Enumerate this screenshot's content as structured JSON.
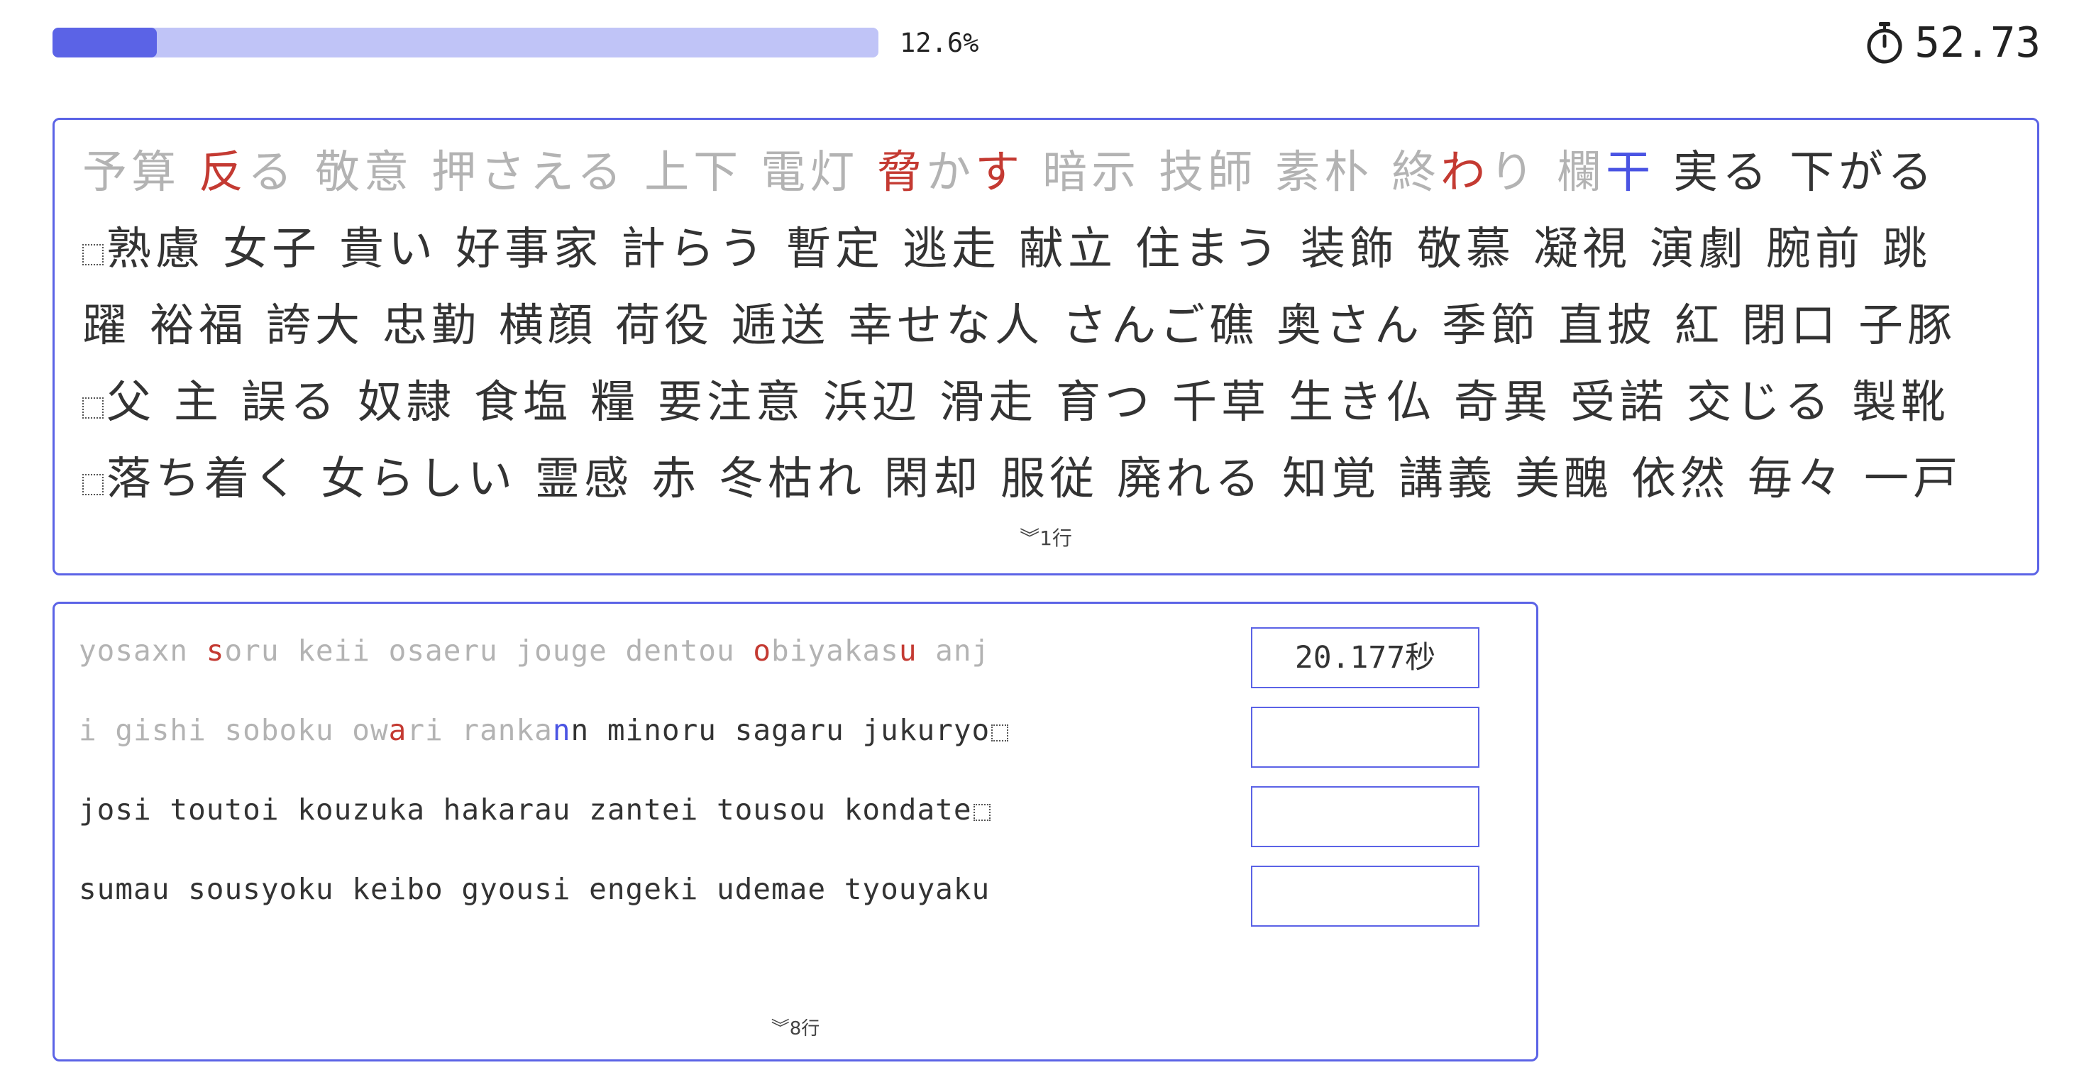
{
  "progress": {
    "fraction": 0.126,
    "label": "12.6%"
  },
  "timer": {
    "icon": "stopwatch-icon",
    "value": "52.73"
  },
  "kanji_panel": {
    "rows": [
      {
        "newline_mark": false,
        "words": [
          {
            "segments": [
              {
                "t": "予算",
                "s": "done"
              }
            ]
          },
          {
            "segments": [
              {
                "t": "反",
                "s": "miss"
              },
              {
                "t": "る",
                "s": "done"
              }
            ]
          },
          {
            "segments": [
              {
                "t": "敬意",
                "s": "done"
              }
            ]
          },
          {
            "segments": [
              {
                "t": "押さえる",
                "s": "done"
              }
            ]
          },
          {
            "segments": [
              {
                "t": "上下",
                "s": "done"
              }
            ]
          },
          {
            "segments": [
              {
                "t": "電灯",
                "s": "done"
              }
            ]
          },
          {
            "segments": [
              {
                "t": "脅",
                "s": "miss"
              },
              {
                "t": "か",
                "s": "done"
              },
              {
                "t": "す",
                "s": "miss"
              }
            ]
          },
          {
            "segments": [
              {
                "t": "暗示",
                "s": "done"
              }
            ]
          },
          {
            "segments": [
              {
                "t": "技師",
                "s": "done"
              }
            ]
          },
          {
            "segments": [
              {
                "t": "素朴",
                "s": "done"
              }
            ]
          },
          {
            "segments": [
              {
                "t": "終",
                "s": "done"
              },
              {
                "t": "わ",
                "s": "miss"
              },
              {
                "t": "り",
                "s": "done"
              }
            ]
          },
          {
            "segments": [
              {
                "t": "欄",
                "s": "done"
              },
              {
                "t": "干",
                "s": "current"
              }
            ]
          },
          {
            "segments": [
              {
                "t": "実る",
                "s": "todo"
              }
            ]
          },
          {
            "segments": [
              {
                "t": "下がる",
                "s": "todo"
              }
            ]
          }
        ]
      },
      {
        "newline_mark": true,
        "words": [
          {
            "segments": [
              {
                "t": "熟慮",
                "s": "todo"
              }
            ]
          },
          {
            "segments": [
              {
                "t": "女子",
                "s": "todo"
              }
            ]
          },
          {
            "segments": [
              {
                "t": "貴い",
                "s": "todo"
              }
            ]
          },
          {
            "segments": [
              {
                "t": "好事家",
                "s": "todo"
              }
            ]
          },
          {
            "segments": [
              {
                "t": "計らう",
                "s": "todo"
              }
            ]
          },
          {
            "segments": [
              {
                "t": "暫定",
                "s": "todo"
              }
            ]
          },
          {
            "segments": [
              {
                "t": "逃走",
                "s": "todo"
              }
            ]
          },
          {
            "segments": [
              {
                "t": "献立",
                "s": "todo"
              }
            ]
          },
          {
            "segments": [
              {
                "t": "住まう",
                "s": "todo"
              }
            ]
          },
          {
            "segments": [
              {
                "t": "装飾",
                "s": "todo"
              }
            ]
          },
          {
            "segments": [
              {
                "t": "敬慕",
                "s": "todo"
              }
            ]
          },
          {
            "segments": [
              {
                "t": "凝視",
                "s": "todo"
              }
            ]
          },
          {
            "segments": [
              {
                "t": "演劇",
                "s": "todo"
              }
            ]
          },
          {
            "segments": [
              {
                "t": "腕前",
                "s": "todo"
              }
            ]
          },
          {
            "segments": [
              {
                "t": "跳",
                "s": "todo"
              }
            ]
          }
        ]
      },
      {
        "newline_mark": false,
        "words": [
          {
            "segments": [
              {
                "t": "躍",
                "s": "todo"
              }
            ]
          },
          {
            "segments": [
              {
                "t": "裕福",
                "s": "todo"
              }
            ]
          },
          {
            "segments": [
              {
                "t": "誇大",
                "s": "todo"
              }
            ]
          },
          {
            "segments": [
              {
                "t": "忠勤",
                "s": "todo"
              }
            ]
          },
          {
            "segments": [
              {
                "t": "横顔",
                "s": "todo"
              }
            ]
          },
          {
            "segments": [
              {
                "t": "荷役",
                "s": "todo"
              }
            ]
          },
          {
            "segments": [
              {
                "t": "逓送",
                "s": "todo"
              }
            ]
          },
          {
            "segments": [
              {
                "t": "幸せな人",
                "s": "todo"
              }
            ]
          },
          {
            "segments": [
              {
                "t": "さんご礁",
                "s": "todo"
              }
            ]
          },
          {
            "segments": [
              {
                "t": "奥さん",
                "s": "todo"
              }
            ]
          },
          {
            "segments": [
              {
                "t": "季節",
                "s": "todo"
              }
            ]
          },
          {
            "segments": [
              {
                "t": "直披",
                "s": "todo"
              }
            ]
          },
          {
            "segments": [
              {
                "t": "紅",
                "s": "todo"
              }
            ]
          },
          {
            "segments": [
              {
                "t": "閉口",
                "s": "todo"
              }
            ]
          },
          {
            "segments": [
              {
                "t": "子豚",
                "s": "todo"
              }
            ]
          }
        ]
      },
      {
        "newline_mark": true,
        "words": [
          {
            "segments": [
              {
                "t": "父",
                "s": "todo"
              }
            ]
          },
          {
            "segments": [
              {
                "t": "主",
                "s": "todo"
              }
            ]
          },
          {
            "segments": [
              {
                "t": "誤る",
                "s": "todo"
              }
            ]
          },
          {
            "segments": [
              {
                "t": "奴隷",
                "s": "todo"
              }
            ]
          },
          {
            "segments": [
              {
                "t": "食塩",
                "s": "todo"
              }
            ]
          },
          {
            "segments": [
              {
                "t": "糧",
                "s": "todo"
              }
            ]
          },
          {
            "segments": [
              {
                "t": "要注意",
                "s": "todo"
              }
            ]
          },
          {
            "segments": [
              {
                "t": "浜辺",
                "s": "todo"
              }
            ]
          },
          {
            "segments": [
              {
                "t": "滑走",
                "s": "todo"
              }
            ]
          },
          {
            "segments": [
              {
                "t": "育つ",
                "s": "todo"
              }
            ]
          },
          {
            "segments": [
              {
                "t": "千草",
                "s": "todo"
              }
            ]
          },
          {
            "segments": [
              {
                "t": "生き仏",
                "s": "todo"
              }
            ]
          },
          {
            "segments": [
              {
                "t": "奇異",
                "s": "todo"
              }
            ]
          },
          {
            "segments": [
              {
                "t": "受諾",
                "s": "todo"
              }
            ]
          },
          {
            "segments": [
              {
                "t": "交じる",
                "s": "todo"
              }
            ]
          },
          {
            "segments": [
              {
                "t": "製靴",
                "s": "todo"
              }
            ]
          }
        ]
      },
      {
        "newline_mark": true,
        "words": [
          {
            "segments": [
              {
                "t": "落ち着く",
                "s": "todo"
              }
            ]
          },
          {
            "segments": [
              {
                "t": "女らしい",
                "s": "todo"
              }
            ]
          },
          {
            "segments": [
              {
                "t": "霊感",
                "s": "todo"
              }
            ]
          },
          {
            "segments": [
              {
                "t": "赤",
                "s": "todo"
              }
            ]
          },
          {
            "segments": [
              {
                "t": "冬枯れ",
                "s": "todo"
              }
            ]
          },
          {
            "segments": [
              {
                "t": "閑却",
                "s": "todo"
              }
            ]
          },
          {
            "segments": [
              {
                "t": "服従",
                "s": "todo"
              }
            ]
          },
          {
            "segments": [
              {
                "t": "廃れる",
                "s": "todo"
              }
            ]
          },
          {
            "segments": [
              {
                "t": "知覚",
                "s": "todo"
              }
            ]
          },
          {
            "segments": [
              {
                "t": "講義",
                "s": "todo"
              }
            ]
          },
          {
            "segments": [
              {
                "t": "美醜",
                "s": "todo"
              }
            ]
          },
          {
            "segments": [
              {
                "t": "依然",
                "s": "todo"
              }
            ]
          },
          {
            "segments": [
              {
                "t": "毎々",
                "s": "todo"
              }
            ]
          },
          {
            "segments": [
              {
                "t": "一戸",
                "s": "todo"
              }
            ]
          }
        ]
      }
    ],
    "more_indicator": "︾1行"
  },
  "romaji_panel": {
    "rows": [
      {
        "newline_mark": false,
        "segments": [
          {
            "t": "yosaxn ",
            "s": "done"
          },
          {
            "t": "s",
            "s": "miss"
          },
          {
            "t": "oru keii osaeru jouge dentou ",
            "s": "done"
          },
          {
            "t": "o",
            "s": "miss"
          },
          {
            "t": "biyakas",
            "s": "done"
          },
          {
            "t": "u",
            "s": "miss"
          },
          {
            "t": " anj",
            "s": "done"
          }
        ],
        "time": "20.177秒"
      },
      {
        "newline_mark": true,
        "segments": [
          {
            "t": "i gishi soboku ow",
            "s": "done"
          },
          {
            "t": "a",
            "s": "miss"
          },
          {
            "t": "ri ranka",
            "s": "done"
          },
          {
            "t": "n",
            "s": "current"
          },
          {
            "t": "n minoru sagaru jukuryo",
            "s": "todo"
          }
        ],
        "time": ""
      },
      {
        "newline_mark": true,
        "segments": [
          {
            "t": "josi toutoi kouzuka hakarau zantei tousou kondate",
            "s": "todo"
          }
        ],
        "time": ""
      },
      {
        "newline_mark": false,
        "segments": [
          {
            "t": "sumau sousyoku keibo gyousi engeki udemae tyouyaku",
            "s": "todo"
          }
        ],
        "time": ""
      }
    ],
    "more_indicator": "︾8行"
  },
  "colors": {
    "accent": "#5b63e6",
    "accent_light": "#c0c4f7",
    "done": "#b3b3b3",
    "miss": "#c43a32",
    "current": "#4a54e3",
    "todo": "#333333"
  }
}
